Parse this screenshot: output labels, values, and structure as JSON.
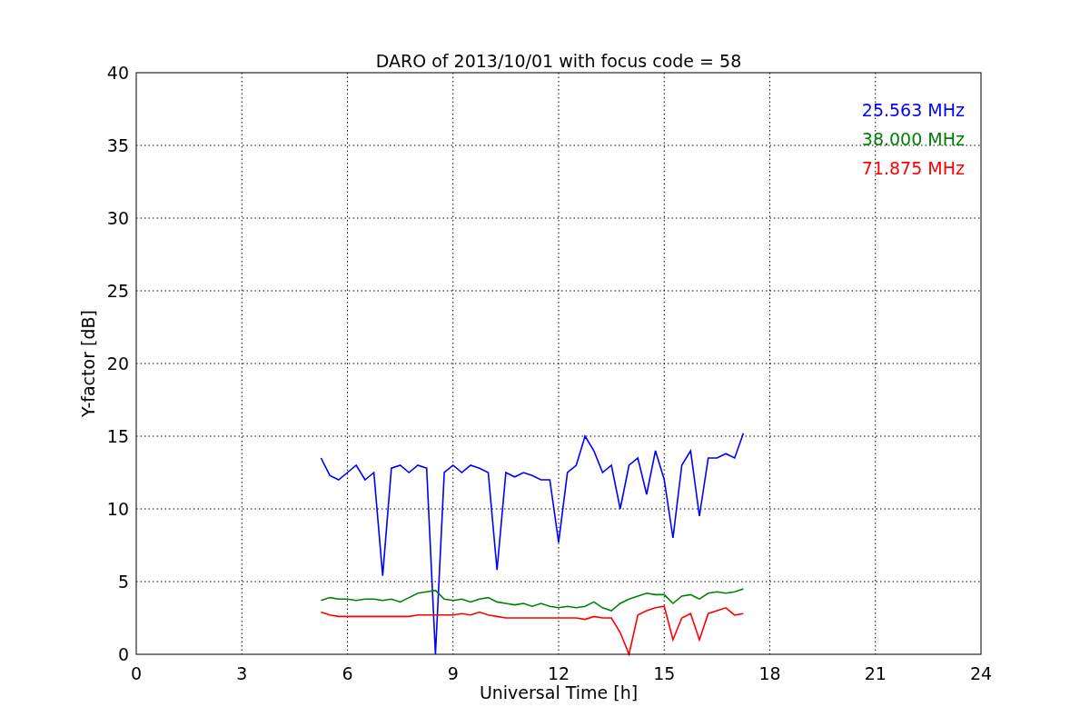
{
  "chart_data": {
    "type": "line",
    "title": "DARO of 2013/10/01 with focus code = 58",
    "xlabel": "Universal Time [h]",
    "ylabel": "Y-factor [dB]",
    "x": [
      5.25,
      5.5,
      5.75,
      6,
      6.25,
      6.5,
      6.75,
      7,
      7.25,
      7.5,
      7.75,
      8,
      8.25,
      8.5,
      8.75,
      9,
      9.25,
      9.5,
      9.75,
      10,
      10.25,
      10.5,
      10.75,
      11,
      11.25,
      11.5,
      11.75,
      12,
      12.25,
      12.5,
      12.75,
      13,
      13.25,
      13.5,
      13.75,
      14,
      14.25,
      14.5,
      14.75,
      15,
      15.25,
      15.5,
      15.75,
      16,
      16.25,
      16.5,
      16.75,
      17,
      17.25
    ],
    "series": [
      {
        "name": "25.563 MHz",
        "color": "#0000ff",
        "values": [
          13.5,
          12.3,
          12,
          12.5,
          13,
          12,
          12.5,
          5.4,
          12.8,
          13,
          12.5,
          13,
          12.8,
          0,
          12.5,
          13,
          12.5,
          13,
          12.8,
          12.5,
          5.8,
          12.5,
          12.2,
          12.5,
          12.3,
          12,
          12,
          7.7,
          12.5,
          13,
          15,
          14,
          12.5,
          13,
          10,
          13,
          13.5,
          11,
          14,
          12,
          8,
          13,
          14,
          9.5,
          13.5,
          13.5,
          13.8,
          13.5,
          15.2
        ]
      },
      {
        "name": "38.000 MHz",
        "color": "#008000",
        "values": [
          3.7,
          3.9,
          3.8,
          3.8,
          3.7,
          3.8,
          3.8,
          3.7,
          3.8,
          3.6,
          3.9,
          4.2,
          4.3,
          4.4,
          3.8,
          3.7,
          3.8,
          3.6,
          3.8,
          3.9,
          3.6,
          3.5,
          3.4,
          3.5,
          3.3,
          3.5,
          3.3,
          3.2,
          3.3,
          3.2,
          3.3,
          3.6,
          3.2,
          3,
          3.5,
          3.8,
          4,
          4.2,
          4.1,
          4.1,
          3.5,
          4,
          4.1,
          3.8,
          4.2,
          4.3,
          4.2,
          4.3,
          4.5
        ]
      },
      {
        "name": "71.875 MHz",
        "color": "#ff0000",
        "values": [
          2.9,
          2.7,
          2.6,
          2.6,
          2.6,
          2.6,
          2.6,
          2.6,
          2.6,
          2.6,
          2.6,
          2.7,
          2.7,
          2.7,
          2.7,
          2.7,
          2.8,
          2.7,
          2.9,
          2.7,
          2.6,
          2.5,
          2.5,
          2.5,
          2.5,
          2.5,
          2.5,
          2.5,
          2.5,
          2.5,
          2.4,
          2.6,
          2.5,
          2.5,
          1.5,
          0,
          2.7,
          3,
          3.2,
          3.3,
          1,
          2.5,
          2.8,
          1,
          2.8,
          3,
          3.2,
          2.7,
          2.8
        ]
      }
    ],
    "grid": true,
    "xlim": [
      0,
      24
    ],
    "ylim": [
      0,
      40
    ],
    "xticks": [
      0,
      3,
      6,
      9,
      12,
      15,
      18,
      21,
      24
    ],
    "yticks": [
      0,
      5,
      10,
      15,
      20,
      25,
      30,
      35,
      40
    ]
  }
}
